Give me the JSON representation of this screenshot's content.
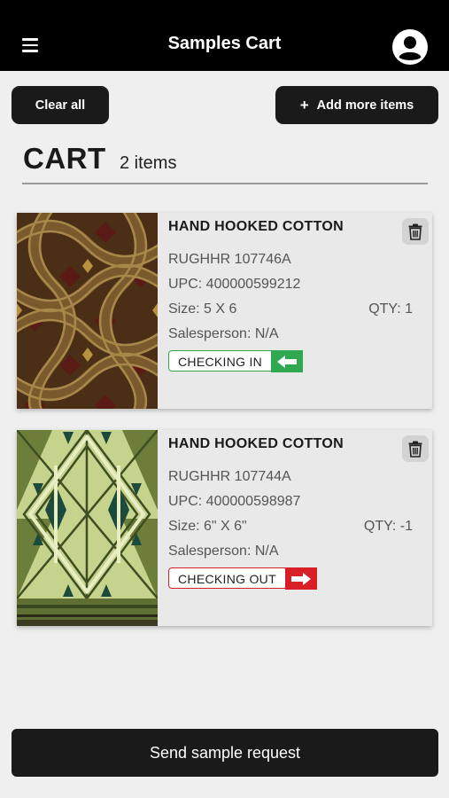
{
  "header": {
    "title": "Samples Cart",
    "menu_icon": "hamburger-menu-icon",
    "account_icon": "account-circle-icon"
  },
  "actions": {
    "clear_label": "Clear all",
    "add_label": "Add more items",
    "add_icon": "+"
  },
  "cart": {
    "title": "CART",
    "count": "2 items"
  },
  "items": [
    {
      "name": "HAND HOOKED COTTON",
      "sku": "RUGHHR 107746A",
      "upc": "UPC: 400000599212",
      "size": "Size: 5 X 6",
      "qty": "QTY: 1",
      "salesperson": "Salesperson:  N/A",
      "status": "CHECKING IN",
      "status_color": "#2fa84f",
      "status_icon": "arrow-left-icon",
      "swatch": "brown interlocking rope pattern"
    },
    {
      "name": "HAND HOOKED COTTON",
      "sku": "RUGHHR 107744A",
      "upc": "UPC: 400000598987",
      "size": "Size: 6\" X 6\"",
      "qty": "QTY: -1",
      "salesperson": "Salesperson:  N/A",
      "status": "CHECKING OUT",
      "status_color": "#d81f26",
      "status_icon": "arrow-right-icon",
      "swatch": "green geometric diamond pattern"
    }
  ],
  "footer": {
    "send_label": "Send sample request"
  }
}
